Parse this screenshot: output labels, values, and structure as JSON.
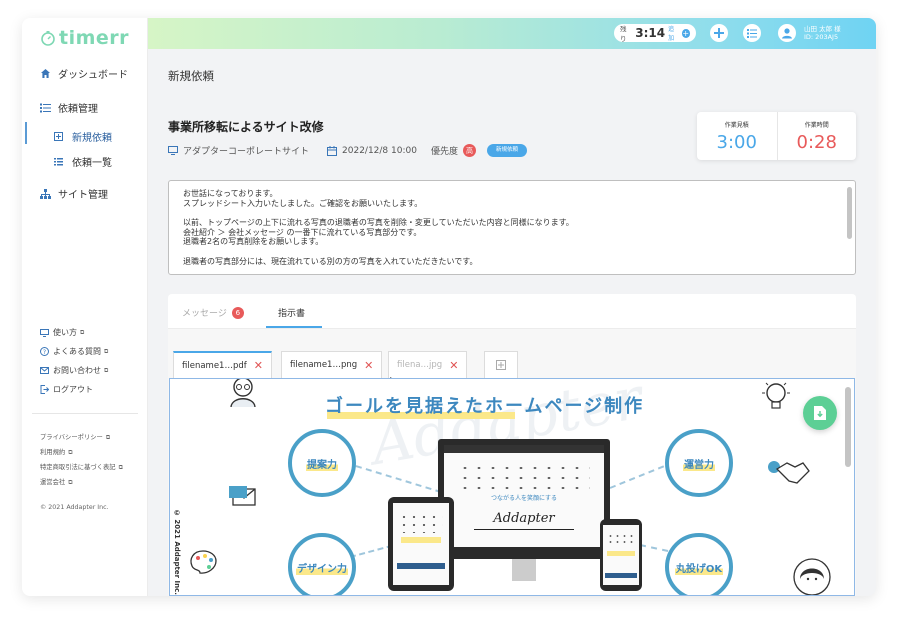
{
  "app": {
    "logo": "timerr"
  },
  "sidebar": {
    "items": [
      {
        "label": "ダッシュボード",
        "icon": "home-icon"
      },
      {
        "label": "依頼管理",
        "icon": "list-icon"
      },
      {
        "label": "サイト管理",
        "icon": "sitemap-icon"
      }
    ],
    "subitems": [
      {
        "label": "新規依頼",
        "icon": "add-square-icon",
        "active": true
      },
      {
        "label": "依頼一覧",
        "icon": "list-icon"
      }
    ],
    "help_links": [
      {
        "label": "使い方",
        "icon": "monitor-icon"
      },
      {
        "label": "よくある質問",
        "icon": "question-circle-icon"
      },
      {
        "label": "お問い合わせ",
        "icon": "mail-icon"
      },
      {
        "label": "ログアウト",
        "icon": "logout-icon"
      }
    ],
    "legal_links": [
      "プライバシーポリシー",
      "利用規約",
      "特定商取引法に基づく表記",
      "運営会社"
    ],
    "copyright": "© 2021 Addapter Inc."
  },
  "topbar": {
    "remaining_label": "残り",
    "remaining_time": "3:14",
    "add_label": "追加",
    "user_name": "山田 太郎 様",
    "user_id": "ID: 203AJ5"
  },
  "page": {
    "title": "新規依頼"
  },
  "request": {
    "title": "事業所移転によるサイト改修",
    "site": "アダプターコーポレートサイト",
    "datetime": "2022/12/8 10:00",
    "priority_label": "優先度",
    "priority_value": "高",
    "status": "新規依頼",
    "estimate_label": "作業見積",
    "estimate_value": "3:00",
    "worktime_label": "作業時間",
    "worktime_value": "0:28",
    "description": {
      "p1": "お世話になっております。\nスプレッドシート入力いたしました。ご確認をお願いいたします。",
      "p2": "以前、トップページの上下に流れる写真の退職者の写真を削除・変更していただいた内容と同様になります。\n会社紹介 ＞ 会社メッセージ の一番下に流れている写真部分です。\n退職者2名の写真削除をお願いします。",
      "p3": "退職者の写真部分には、現在流れている別の方の写真を入れていただきたいです。"
    }
  },
  "tabs": {
    "messages": "メッセージ",
    "messages_count": "6",
    "instructions": "指示書"
  },
  "files": [
    {
      "name": "filename1…pdf"
    },
    {
      "name": "filename1…png"
    },
    {
      "name": "filena…jpg"
    }
  ],
  "preview": {
    "title": "ゴールを見据えたホームページ制作",
    "watermark": "Addapter",
    "bubbles": [
      "提案力",
      "運営力",
      "デザイン力",
      "丸投げOK"
    ],
    "brand": "Addapter",
    "tagline": "つながる人を笑顔にする",
    "vertical_copyright": "© 2021 Addapter Inc."
  },
  "colors": {
    "accent": "#4aa7e8",
    "brand": "#7fd8b4",
    "danger": "#e85a5a",
    "fab": "#5ccf95"
  }
}
